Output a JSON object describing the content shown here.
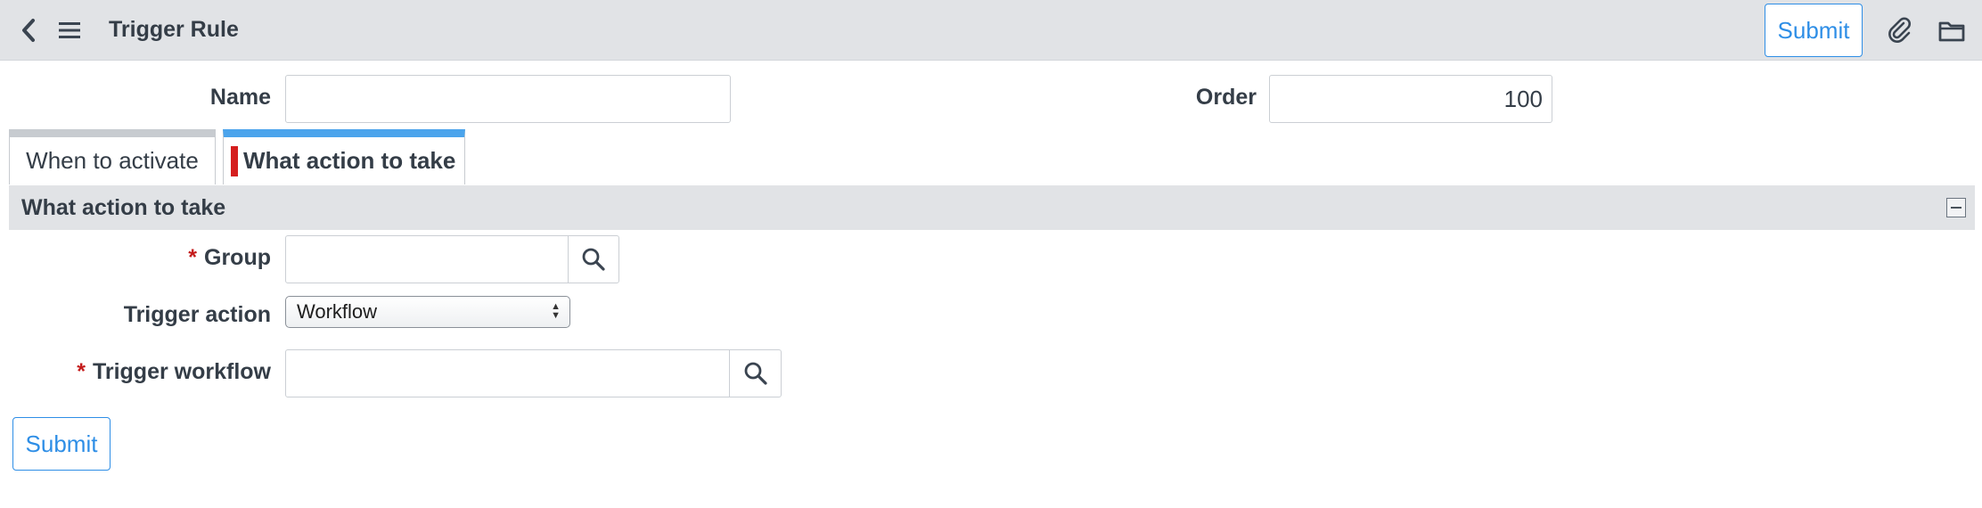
{
  "header": {
    "title": "Trigger Rule",
    "submit_label": "Submit",
    "back_icon": "chevron-left-icon",
    "menu_icon": "hamburger-menu-icon",
    "attach_icon": "paperclip-icon",
    "more_icon": "folder-icon"
  },
  "fields": {
    "name_label": "Name",
    "name_value": "",
    "order_label": "Order",
    "order_value": "100"
  },
  "tabs": [
    {
      "label": "When to activate",
      "active": false
    },
    {
      "label": "What action to take",
      "active": true
    }
  ],
  "section": {
    "title": "What action to take",
    "group_label": "Group",
    "group_value": "",
    "trigger_action_label": "Trigger action",
    "trigger_action_value": "Workflow",
    "trigger_workflow_label": "Trigger workflow",
    "trigger_workflow_value": "",
    "required_marker": "*"
  },
  "footer": {
    "submit_label": "Submit"
  },
  "colors": {
    "accent": "#2e8ee6",
    "required": "#c41b1b",
    "tab_active": "#4ba4ec",
    "header_bg": "#e1e3e6"
  }
}
